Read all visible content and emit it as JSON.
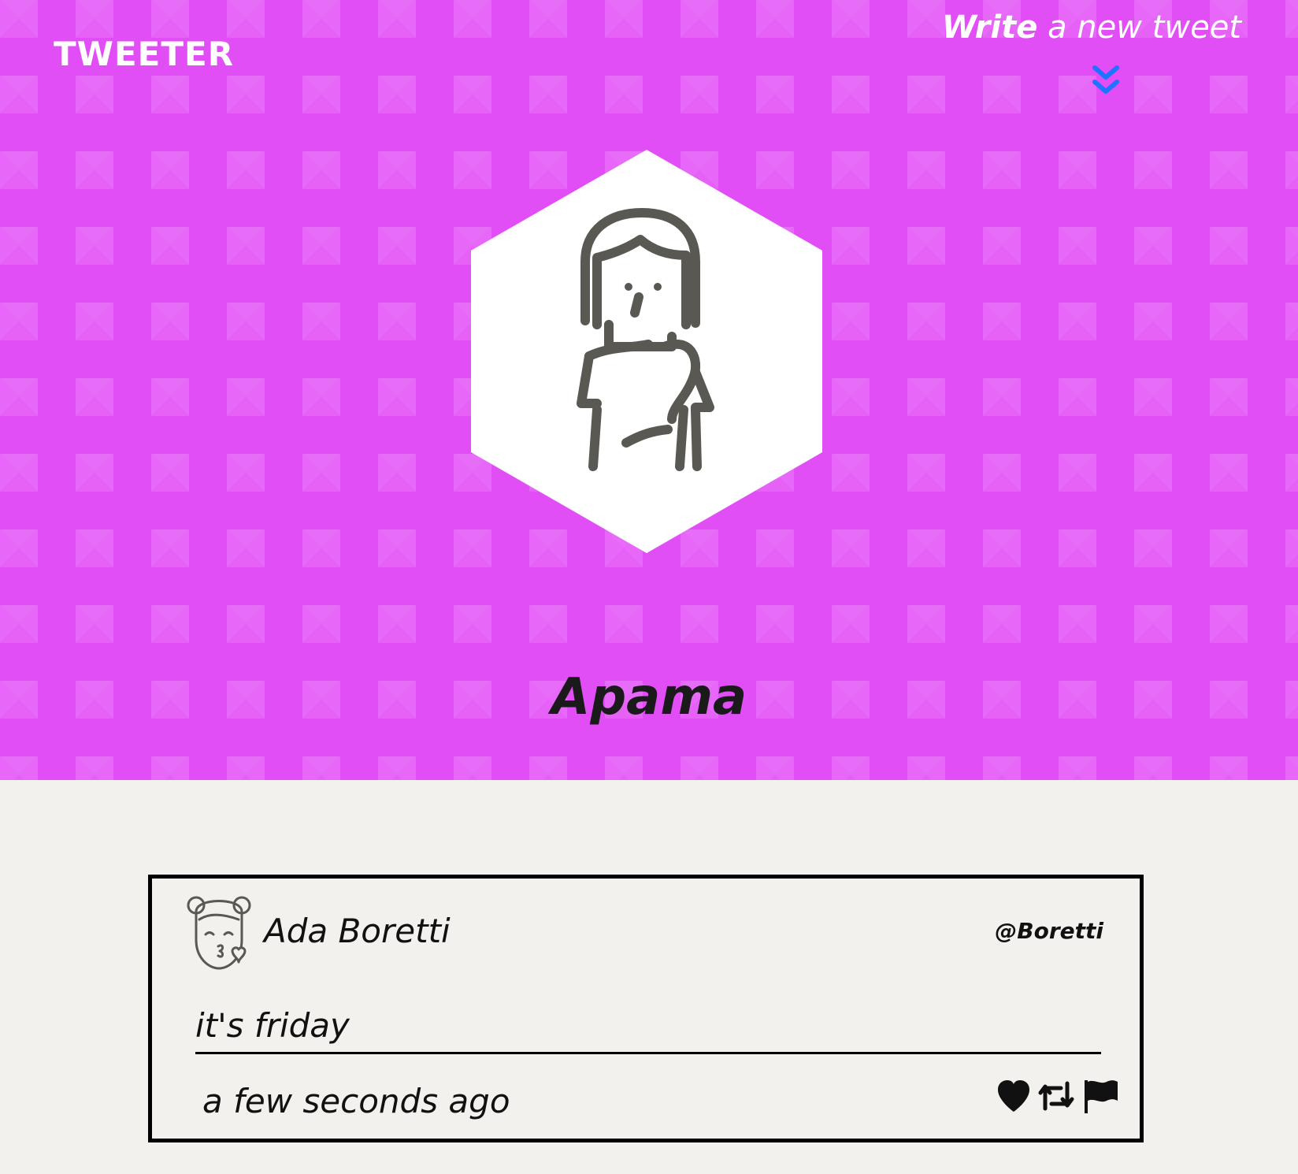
{
  "header": {
    "logo": "TWEETER",
    "compose": {
      "strong": "Write",
      "rest": " a new tweet"
    }
  },
  "profile": {
    "name": "Apama"
  },
  "tweet": {
    "author_name": "Ada Boretti",
    "handle": "@Boretti",
    "text": "it's friday",
    "time": "a few seconds ago"
  },
  "icons": {
    "compose_arrow": "double-chevron-down-icon",
    "profile_avatar": "person-avatar-icon",
    "tweet_avatar": "girl-kiss-avatar-icon",
    "like": "heart-icon",
    "retweet": "retweet-icon",
    "flag": "flag-icon"
  },
  "colors": {
    "header_bg": "#e24ef6",
    "page_bg": "#f3f1ed",
    "accent_arrow": "#1f74ff"
  }
}
